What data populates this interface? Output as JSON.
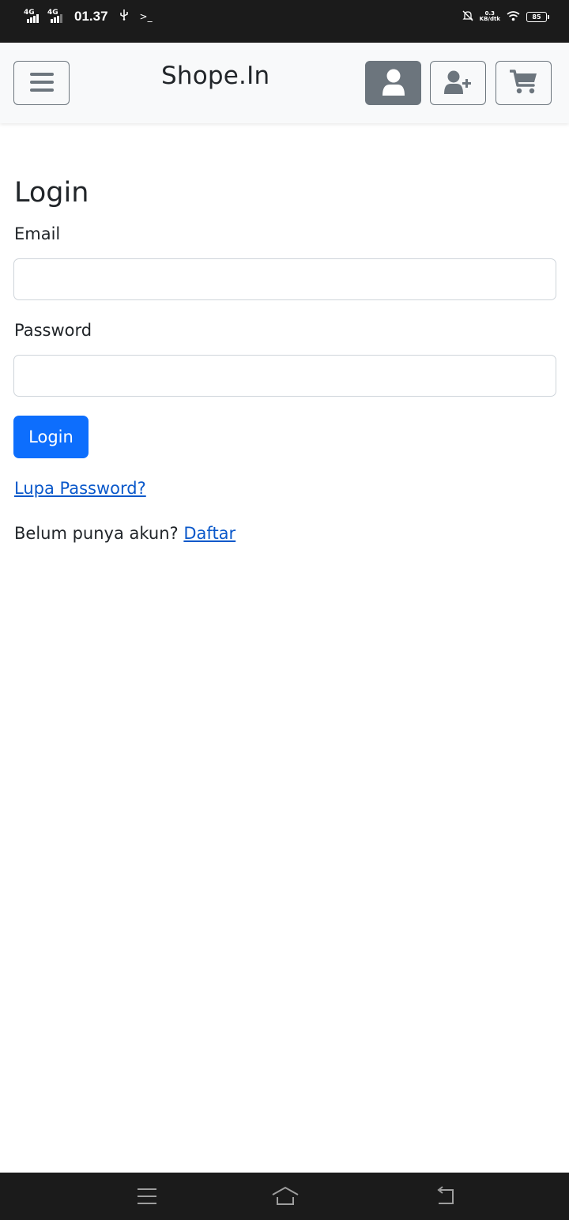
{
  "status_bar": {
    "network1": "4G",
    "network2": "4G",
    "time": "01.37",
    "usb_icon": "usb-icon",
    "terminal_icon": ">_",
    "speed_value": "0.3",
    "speed_unit": "KB/dtk",
    "battery": "85"
  },
  "navbar": {
    "brand": "Shope.In",
    "icons": {
      "menu": "hamburger-menu-icon",
      "account": "user-icon",
      "register": "user-plus-icon",
      "cart": "shopping-cart-icon"
    }
  },
  "login_form": {
    "title": "Login",
    "email_label": "Email",
    "email_value": "",
    "password_label": "Password",
    "password_value": "",
    "submit_label": "Login",
    "forgot_link": "Lupa Password?",
    "no_account_text": "Belum punya akun?",
    "register_link": "Daftar"
  },
  "bottom_nav": {
    "menu_icon": "recent-apps-icon",
    "home_icon": "home-icon",
    "back_icon": "back-icon"
  },
  "colors": {
    "primary": "#0d6efd",
    "link": "#0a58ca",
    "secondary": "#6c757d",
    "navbar_bg": "#f8f9fa",
    "system_bar": "#1b1b1b"
  }
}
